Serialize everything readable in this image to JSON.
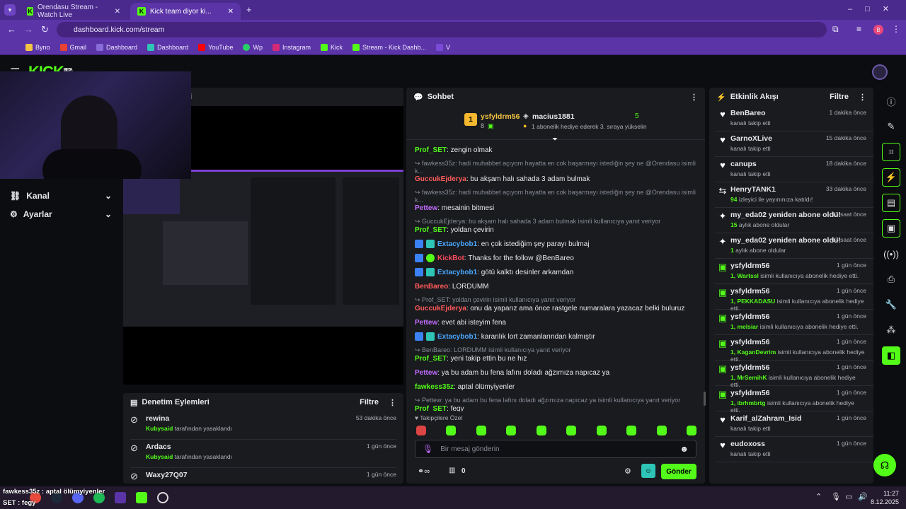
{
  "browser": {
    "tabs": [
      {
        "label": "Orendasu Stream - Watch Live"
      },
      {
        "label": "Kick team diyor ki..."
      }
    ],
    "url": "dashboard.kick.com/stream",
    "bookmarks": [
      "Byno",
      "Gmail",
      "Dashboard",
      "Dashboard",
      "YouTube",
      "Wp",
      "Instagram",
      "Kick",
      "Stream - Kick Dashb...",
      "V"
    ],
    "profile_initial": "B"
  },
  "kick": {
    "logo": "KICK",
    "beta": "BETA"
  },
  "sidebar": {
    "items": [
      {
        "label": "Kanal"
      },
      {
        "label": "Ayarlar"
      }
    ]
  },
  "video": {
    "title_fragment": "i"
  },
  "moderation": {
    "title": "Denetim Eylemleri",
    "filter": "Filtre",
    "items": [
      {
        "name": "rewina",
        "by": "Kubysaid",
        "action": "tarafından yasaklandı",
        "time": "53 dakika önce"
      },
      {
        "name": "Ardacs",
        "by": "Kubysaid",
        "action": "tarafından yasaklandı",
        "time": "1 gün önce"
      },
      {
        "name": "Waxy27Q07",
        "by": "",
        "action": "",
        "time": "1 gün önce"
      }
    ]
  },
  "chat": {
    "title": "Sohbet",
    "top1": {
      "rank": "1",
      "user": "ysfyldrm56",
      "count": "8"
    },
    "top2": {
      "user": "macius1881",
      "count": "5",
      "note": "1 abonelik hediye ederek 3. sıraya yükselin"
    },
    "messages": [
      {
        "user": "Prof_SET",
        "color": "#53fc18",
        "text": "zengin olmak"
      },
      {
        "reply": "fawkess35z: hadi muhabbet açıyom hayatta en cok başarmayı istediğin şey ne @Orendasu isimli k...",
        "user": "GuccukEjderya",
        "color": "#ff5a5a",
        "text": "bu akşam halı sahada 3 adam bulmak"
      },
      {
        "reply": "fawkess35z: hadi muhabbet açıyom hayatta en cok başarmayı istediğin şey ne @Orendasu isimli k...",
        "user": "Pettew",
        "color": "#c36cff",
        "text": "mesainin bitmesi"
      },
      {
        "reply": "GuccukEjderya: bu akşam halı sahada 3 adam bulmak isimli kullanıcıya yanıt veriyor",
        "user": "Prof_SET",
        "color": "#53fc18",
        "text": "yoldan çevirin"
      },
      {
        "badges": true,
        "user": "Extacybob1",
        "color": "#4aa8ff",
        "text": "en çok istediğim şey parayı bulmaj"
      },
      {
        "badges": true,
        "bot": true,
        "user": "KickBot",
        "color": "#ff4b5c",
        "text": "Thanks for the follow @BenBareo"
      },
      {
        "badges": true,
        "user": "Extacybob1",
        "color": "#4aa8ff",
        "text": "götü kalktı desinler arkamdan"
      },
      {
        "user": "BenBareo",
        "color": "#ff5a5a",
        "text": "LORDUMM"
      },
      {
        "reply": "Prof_SET: yoldan çevirin isimli kullanıcıya yanıt veriyor",
        "user": "GuccukEjderya",
        "color": "#ff5a5a",
        "text": "onu da yaparız ama önce rastgele numaralara yazacaz belki buluruz"
      },
      {
        "user": "Pettew",
        "color": "#c36cff",
        "text": "evet abi isteyim fena"
      },
      {
        "badges": true,
        "user": "Extacybob1",
        "color": "#4aa8ff",
        "text": "karanlık lort zamanlarından kalmıştır"
      },
      {
        "reply": "BenBareo: LORDUMM isimli kullanıcıya yanıt veriyor",
        "user": "Prof_SET",
        "color": "#53fc18",
        "text": "yeni takip ettin bu ne hız"
      },
      {
        "user": "Pettew",
        "color": "#c36cff",
        "text": "ya bu adam bu fena lafını doladı ağzımıza napıcaz ya"
      },
      {
        "user": "fawkess35z",
        "color": "#53fc18",
        "text": "aptal ölümyiyenler"
      },
      {
        "reply": "Pettew: ya bu adam bu fena lafını doladı ağzımıza napıcaz ya isimli kullanıcıya yanıt veriyor",
        "user": "Prof_SET",
        "color": "#53fc18",
        "text": "fegy"
      }
    ],
    "emote_label": "Takipçilere Özel",
    "input_placeholder": "Bir mesaj gönderin",
    "points": "0",
    "send": "Gönder"
  },
  "activity": {
    "title": "Etkinlik Akışı",
    "filter": "Filtre",
    "items": [
      {
        "icon": "heart",
        "title": "BenBareo",
        "sub": "kanalı takip etti",
        "time": "1 dakika önce"
      },
      {
        "icon": "heart",
        "title": "GarnoXLive",
        "sub": "kanalı takip etti",
        "time": "15 dakika önce"
      },
      {
        "icon": "heart",
        "title": "canups",
        "sub": "kanalı takip etti",
        "time": "18 dakika önce"
      },
      {
        "icon": "host",
        "title": "HenryTANK1",
        "hl": "94",
        "sub": "izleyici ile yayınınıza katıldı!",
        "time": "33 dakika önce"
      },
      {
        "icon": "star",
        "title": "my_eda02 yeniden abone oldu!",
        "hl": "15",
        "sub": "aylık abone oldular",
        "time": "13 saat önce"
      },
      {
        "icon": "star",
        "title": "my_eda02 yeniden abone oldu!",
        "hl": "1",
        "sub": "aylık abone oldular",
        "time": "13 saat önce"
      },
      {
        "icon": "gift",
        "title": "ysfyldrm56",
        "hl": "1, Wartssl",
        "sub": "isimli kullanıcıya abonelik hediye etti.",
        "time": "1 gün önce"
      },
      {
        "icon": "gift",
        "title": "ysfyldrm56",
        "hl": "1, PEKKADASU",
        "sub": "isimli kullanıcıya abonelik hediye etti.",
        "time": "1 gün önce"
      },
      {
        "icon": "gift",
        "title": "ysfyldrm56",
        "hl": "1, melsiar",
        "sub": "isimli kullanıcıya abonelik hediye etti.",
        "time": "1 gün önce"
      },
      {
        "icon": "gift",
        "title": "ysfyldrm56",
        "hl": "1, KaganDevrim",
        "sub": "isimli kullanıcıya abonelik hediye etti.",
        "time": "1 gün önce"
      },
      {
        "icon": "gift",
        "title": "ysfyldrm56",
        "hl": "1, MrSemihK",
        "sub": "isimli kullanıcıya abonelik hediye etti.",
        "time": "1 gün önce"
      },
      {
        "icon": "gift",
        "title": "ysfyldrm56",
        "hl": "1, ibrhmbrtg",
        "sub": "isimli kullanıcıya abonelik hediye etti.",
        "time": "1 gün önce"
      },
      {
        "icon": "heart",
        "title": "Karif_alZahram_Isid",
        "sub": "kanalı takip etti",
        "time": "1 gün önce"
      },
      {
        "icon": "heart",
        "title": "eudoxoss",
        "sub": "kanalı takip etti",
        "time": "1 gün önce"
      }
    ]
  },
  "overlay": {
    "line1": "fawkess35z : aptal ölümyiyenler",
    "line2": "SET : fegy"
  },
  "taskbar": {
    "time": "11:27",
    "date": "8.12.2025"
  },
  "colors": {
    "kick_green": "#53fc18",
    "browser_purple": "#5b34a8"
  }
}
